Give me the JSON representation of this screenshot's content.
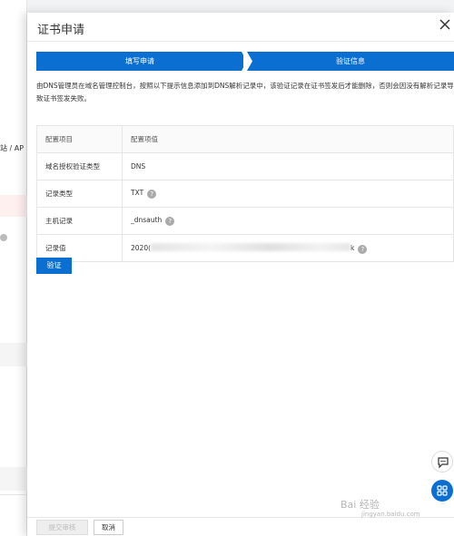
{
  "drawer": {
    "title": "证书申请",
    "steps": [
      {
        "label": "填写申请"
      },
      {
        "label": "验证信息"
      }
    ],
    "description": "由DNS管理员在域名管理控制台，按照以下提示信息添加到DNS解析记录中，该验证记录在证书签发后才能删除，否则会因没有解析记录导致证书签发失败。",
    "table": {
      "headers": [
        "配置项目",
        "配置项值"
      ],
      "rows": [
        {
          "key": "域名授权验证类型",
          "value": "DNS",
          "help": false
        },
        {
          "key": "记录类型",
          "value": "TXT",
          "help": true
        },
        {
          "key": "主机记录",
          "value": "_dnsauth",
          "help": true
        },
        {
          "key": "记录值",
          "value_prefix": "2020(",
          "value_suffix": "k",
          "help": true
        }
      ]
    },
    "verify_label": "验证",
    "submit_label": "提交审核",
    "cancel_label": "取消"
  },
  "background": {
    "breadcrumb_fragment": "站 / AP"
  },
  "watermark": {
    "text": "Bai 经验",
    "sub": "jingyan.baidu.com"
  },
  "colors": {
    "primary": "#0a6fd0",
    "help": "#aaaaaa"
  },
  "icons": [
    "close-icon",
    "help-icon",
    "chat-icon",
    "apps-icon"
  ]
}
